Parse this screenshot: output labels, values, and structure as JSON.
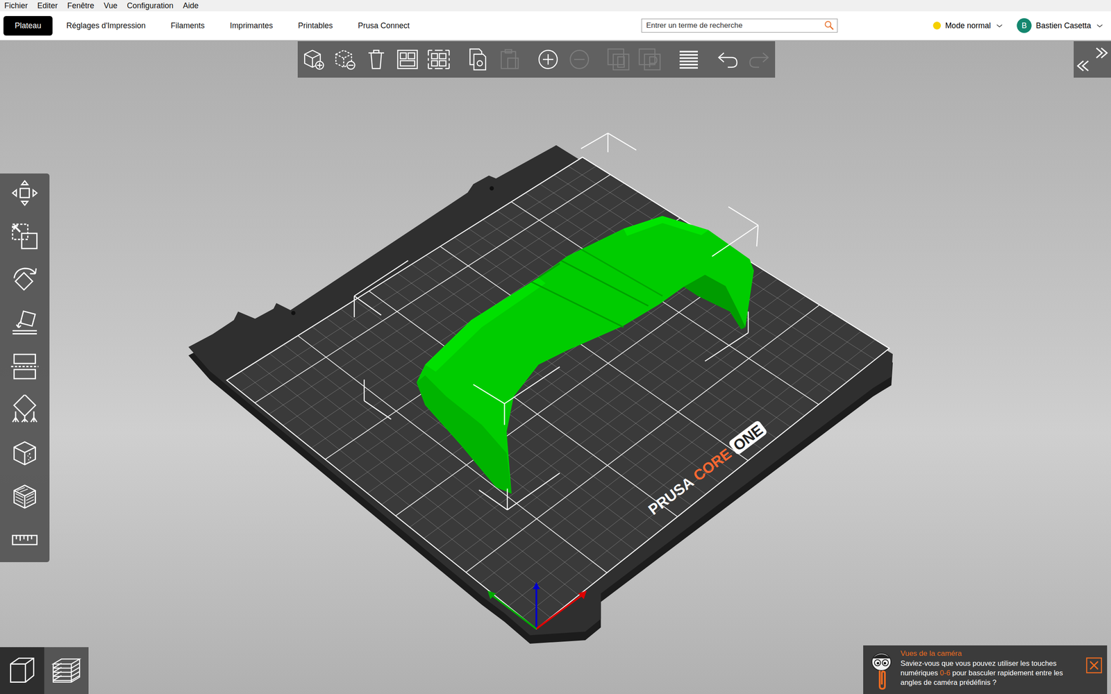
{
  "menu": [
    "Fichier",
    "Editer",
    "Fenêtre",
    "Vue",
    "Configuration",
    "Aide"
  ],
  "tabs": [
    {
      "label": "Plateau",
      "selected": true
    },
    {
      "label": "Réglages d'Impression",
      "selected": false
    },
    {
      "label": "Filaments",
      "selected": false
    },
    {
      "label": "Imprimantes",
      "selected": false
    },
    {
      "label": "Printables",
      "selected": false
    },
    {
      "label": "Prusa Connect",
      "selected": false
    }
  ],
  "search": {
    "placeholder": "Entrer un terme de recherche"
  },
  "mode": {
    "label": "Mode normal",
    "color": "#f5d000"
  },
  "user": {
    "initial": "B",
    "name": "Bastien Casetta"
  },
  "top_toolbar": [
    {
      "kind": "add",
      "disabled": false
    },
    {
      "kind": "delete",
      "disabled": false
    },
    {
      "kind": "delete-all",
      "disabled": false
    },
    {
      "kind": "arrange",
      "disabled": false
    },
    {
      "kind": "arrange-selection",
      "disabled": false
    },
    {
      "kind": "copy",
      "disabled": false
    },
    {
      "kind": "paste",
      "disabled": true
    },
    {
      "kind": "add-instance",
      "disabled": false
    },
    {
      "kind": "remove-instance",
      "disabled": true
    },
    {
      "kind": "split-objects",
      "disabled": true
    },
    {
      "kind": "split-parts",
      "disabled": true
    },
    {
      "kind": "layers",
      "disabled": false
    },
    {
      "kind": "undo",
      "disabled": false
    },
    {
      "kind": "redo",
      "disabled": true
    }
  ],
  "left_toolbar": [
    {
      "kind": "move"
    },
    {
      "kind": "scale"
    },
    {
      "kind": "rotate"
    },
    {
      "kind": "place-on-face"
    },
    {
      "kind": "cut"
    },
    {
      "kind": "supports"
    },
    {
      "kind": "seam"
    },
    {
      "kind": "fuzzy"
    },
    {
      "kind": "measure"
    }
  ],
  "view_buttons": [
    {
      "kind": "3d",
      "selected": true
    },
    {
      "kind": "preview",
      "selected": false
    }
  ],
  "bed": {
    "logo": [
      "PRUSA",
      "CORE",
      "ONE"
    ]
  },
  "hint": {
    "title": "Vues de la caméra",
    "text_before": "Saviez-vous que vous pouvez utiliser les touches numériques ",
    "highlight": "0-6",
    "text_after": " pour basculer rapidement entre les angles de caméra prédéfinis ?"
  }
}
